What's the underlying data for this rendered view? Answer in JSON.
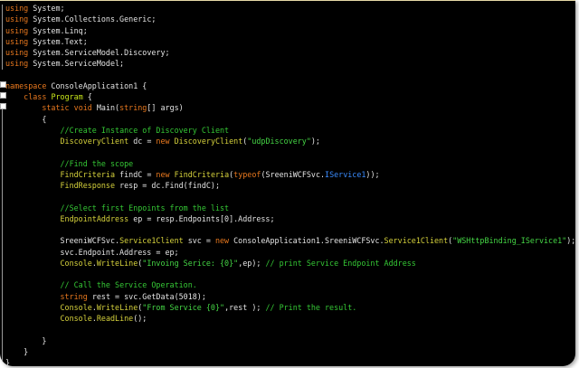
{
  "colors": {
    "background": "#000000",
    "keyword": "#e8781e",
    "type": "#d6d23c",
    "comment": "#35c835",
    "string": "#45d645",
    "interface": "#3a8cff",
    "text": "#e4e4e4"
  },
  "lines": [
    [
      [
        "kw",
        "using"
      ],
      [
        "txt",
        " System;"
      ]
    ],
    [
      [
        "kw",
        "using"
      ],
      [
        "txt",
        " System.Collections.Generic;"
      ]
    ],
    [
      [
        "kw",
        "using"
      ],
      [
        "txt",
        " System.Linq;"
      ]
    ],
    [
      [
        "kw",
        "using"
      ],
      [
        "txt",
        " System.Text;"
      ]
    ],
    [
      [
        "kw",
        "using"
      ],
      [
        "txt",
        " System.ServiceModel.Discovery;"
      ]
    ],
    [
      [
        "kw",
        "using"
      ],
      [
        "txt",
        " System.ServiceModel;"
      ]
    ],
    [],
    [
      [
        "kw",
        "namespace"
      ],
      [
        "txt",
        " ConsoleApplication1 {"
      ]
    ],
    [
      [
        "txt",
        "    "
      ],
      [
        "kw",
        "class"
      ],
      [
        "txt",
        " "
      ],
      [
        "cls",
        "Program"
      ],
      [
        "txt",
        " {"
      ]
    ],
    [
      [
        "txt",
        "        "
      ],
      [
        "kw",
        "static"
      ],
      [
        "txt",
        " "
      ],
      [
        "kw",
        "void"
      ],
      [
        "txt",
        " Main("
      ],
      [
        "kw",
        "string"
      ],
      [
        "txt",
        "[] args)"
      ]
    ],
    [
      [
        "txt",
        "        {"
      ]
    ],
    [
      [
        "txt",
        "            "
      ],
      [
        "cm",
        "//Create Instance of Discovery Client"
      ]
    ],
    [
      [
        "txt",
        "            "
      ],
      [
        "type",
        "DiscoveryClient"
      ],
      [
        "txt",
        " dc = "
      ],
      [
        "kw",
        "new"
      ],
      [
        "txt",
        " "
      ],
      [
        "type",
        "DiscoveryClient"
      ],
      [
        "txt",
        "("
      ],
      [
        "str",
        "\"udpDiscovery\""
      ],
      [
        "txt",
        ");"
      ]
    ],
    [],
    [
      [
        "txt",
        "            "
      ],
      [
        "cm",
        "//Find the scope"
      ]
    ],
    [
      [
        "txt",
        "            "
      ],
      [
        "type",
        "FindCriteria"
      ],
      [
        "txt",
        " findC = "
      ],
      [
        "kw",
        "new"
      ],
      [
        "txt",
        " "
      ],
      [
        "type",
        "FindCriteria"
      ],
      [
        "txt",
        "("
      ],
      [
        "kw",
        "typeof"
      ],
      [
        "txt",
        "(SreeniWCFSvc."
      ],
      [
        "iface",
        "IService1"
      ],
      [
        "txt",
        "));"
      ]
    ],
    [
      [
        "txt",
        "            "
      ],
      [
        "type",
        "FindResponse"
      ],
      [
        "txt",
        " resp = dc.Find(findC);"
      ]
    ],
    [],
    [
      [
        "txt",
        "            "
      ],
      [
        "cm",
        "//Select first Enpoints from the list"
      ]
    ],
    [
      [
        "txt",
        "            "
      ],
      [
        "type",
        "EndpointAddress"
      ],
      [
        "txt",
        " ep = resp.Endpoints[0].Address;"
      ]
    ],
    [],
    [
      [
        "txt",
        "            SreeniWCFSvc."
      ],
      [
        "type",
        "Service1Client"
      ],
      [
        "txt",
        " svc = "
      ],
      [
        "kw",
        "new"
      ],
      [
        "txt",
        " ConsoleApplication1.SreeniWCFSvc."
      ],
      [
        "type",
        "Service1Client"
      ],
      [
        "txt",
        "("
      ],
      [
        "str",
        "\"WSHttpBinding_IService1\""
      ],
      [
        "txt",
        ");"
      ]
    ],
    [
      [
        "txt",
        "            svc.Endpoint.Address = ep;"
      ]
    ],
    [
      [
        "txt",
        "            "
      ],
      [
        "type",
        "Console"
      ],
      [
        "txt",
        "."
      ],
      [
        "type",
        "WriteLine"
      ],
      [
        "txt",
        "("
      ],
      [
        "str",
        "\"Invoing Serice: {0}\""
      ],
      [
        "txt",
        ",ep); "
      ],
      [
        "cm",
        "// print Service Endpoint Address"
      ]
    ],
    [],
    [
      [
        "txt",
        "            "
      ],
      [
        "cm",
        "// Call the Service Operation."
      ]
    ],
    [
      [
        "txt",
        "            "
      ],
      [
        "kw",
        "string"
      ],
      [
        "txt",
        " rest = svc.GetData(5018);"
      ]
    ],
    [
      [
        "txt",
        "            "
      ],
      [
        "type",
        "Console"
      ],
      [
        "txt",
        "."
      ],
      [
        "type",
        "WriteLine"
      ],
      [
        "txt",
        "("
      ],
      [
        "str",
        "\"From Service {0}\""
      ],
      [
        "txt",
        ",rest ); "
      ],
      [
        "cm",
        "// Print the result."
      ]
    ],
    [
      [
        "txt",
        "            "
      ],
      [
        "type",
        "Console"
      ],
      [
        "txt",
        "."
      ],
      [
        "type",
        "ReadLine"
      ],
      [
        "txt",
        "();"
      ]
    ],
    [],
    [
      [
        "txt",
        "        }"
      ]
    ],
    [
      [
        "txt",
        "    }"
      ]
    ],
    [
      [
        "txt",
        "}"
      ]
    ]
  ]
}
